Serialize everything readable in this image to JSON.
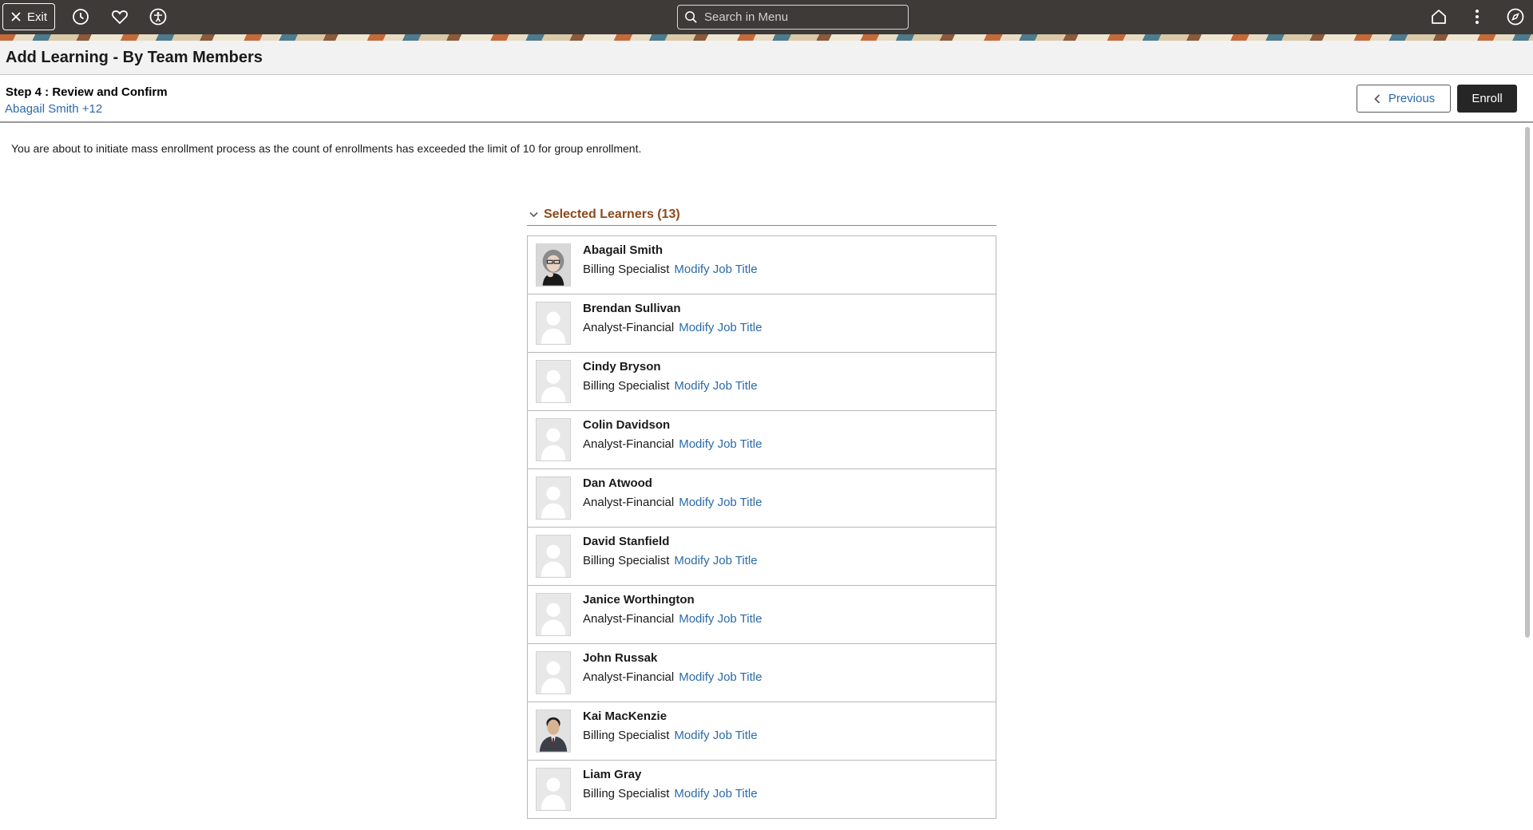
{
  "topbar": {
    "exit_label": "Exit",
    "search_placeholder": "Search in Menu",
    "icons": [
      "close-icon",
      "history-icon",
      "favorites-icon",
      "accessibility-icon",
      "home-icon",
      "more-icon",
      "navigator-icon"
    ]
  },
  "page": {
    "title": "Add Learning - By Team Members"
  },
  "step": {
    "title": "Step 4 : Review and Confirm",
    "learners_link": "Abagail Smith +12",
    "previous_label": "Previous",
    "enroll_label": "Enroll"
  },
  "message": "You are about to initiate mass enrollment process as the count of enrollments has exceeded the limit of 10 for group enrollment.",
  "section": {
    "title": "Selected Learners (13)",
    "learners": [
      {
        "name": "Abagail Smith",
        "job": "Billing Specialist",
        "action": "Modify Job Title",
        "photo": "photo-woman"
      },
      {
        "name": "Brendan Sullivan",
        "job": "Analyst-Financial",
        "action": "Modify Job Title",
        "photo": "placeholder"
      },
      {
        "name": "Cindy Bryson",
        "job": "Billing Specialist",
        "action": "Modify Job Title",
        "photo": "placeholder"
      },
      {
        "name": "Colin Davidson",
        "job": "Analyst-Financial",
        "action": "Modify Job Title",
        "photo": "placeholder"
      },
      {
        "name": "Dan Atwood",
        "job": "Analyst-Financial",
        "action": "Modify Job Title",
        "photo": "placeholder"
      },
      {
        "name": "David Stanfield",
        "job": "Billing Specialist",
        "action": "Modify Job Title",
        "photo": "placeholder"
      },
      {
        "name": "Janice Worthington",
        "job": "Analyst-Financial",
        "action": "Modify Job Title",
        "photo": "placeholder"
      },
      {
        "name": "John Russak",
        "job": "Analyst-Financial",
        "action": "Modify Job Title",
        "photo": "placeholder"
      },
      {
        "name": "Kai MacKenzie",
        "job": "Billing Specialist",
        "action": "Modify Job Title",
        "photo": "photo-man"
      },
      {
        "name": "Liam Gray",
        "job": "Billing Specialist",
        "action": "Modify Job Title",
        "photo": "placeholder"
      }
    ]
  },
  "colors": {
    "header_bg": "#3d3a38",
    "link": "#2b6aa8",
    "section_title": "#8b4a1c",
    "enroll_bg": "#262626"
  }
}
